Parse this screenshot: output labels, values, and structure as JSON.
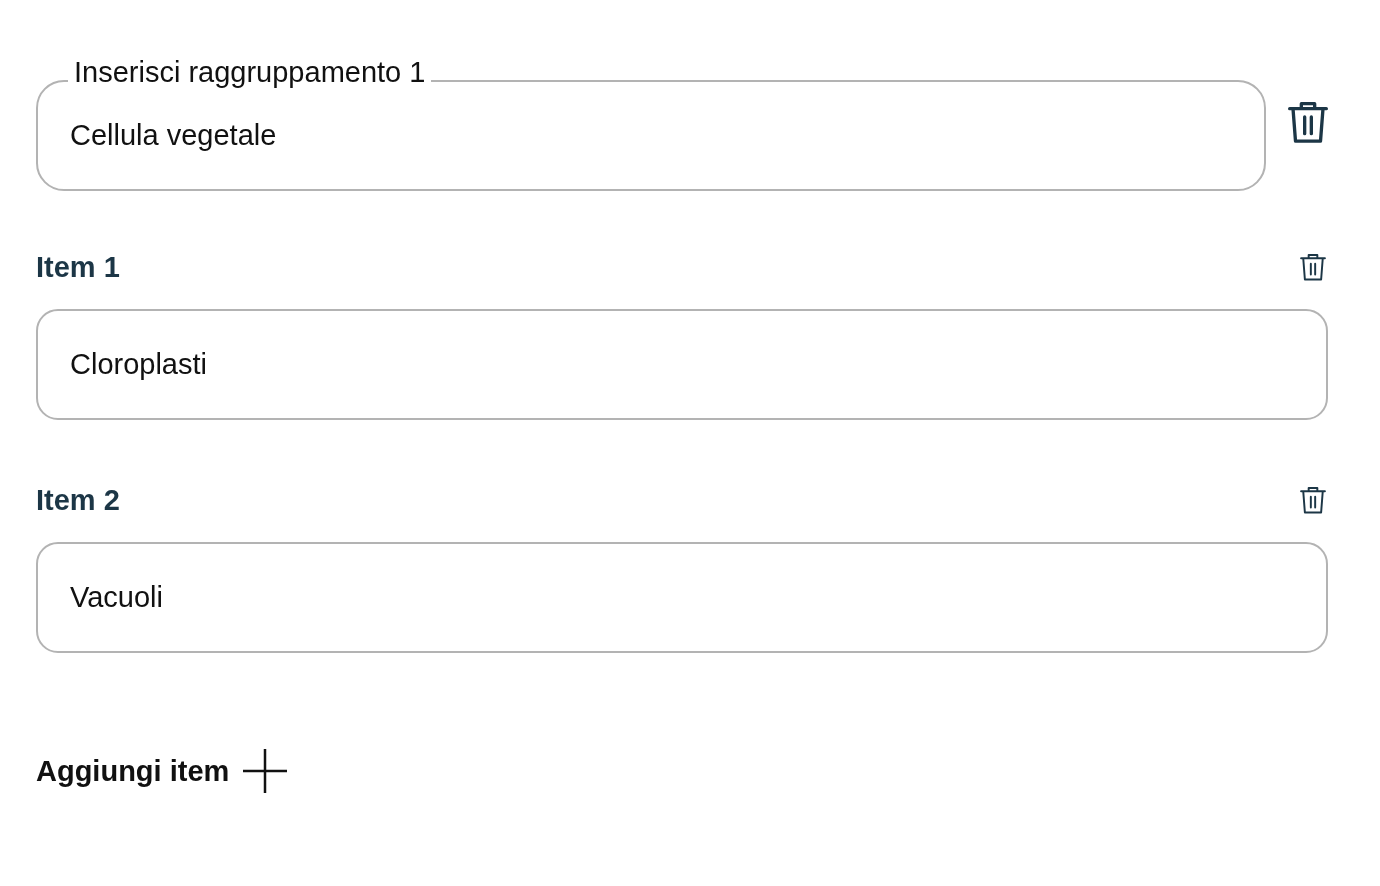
{
  "group": {
    "label": "Inserisci raggruppamento 1",
    "value": "Cellula vegetale"
  },
  "items": [
    {
      "label": "Item 1",
      "value": "Cloroplasti"
    },
    {
      "label": "Item 2",
      "value": "Vacuoli"
    }
  ],
  "add_button": {
    "label": "Aggiungi item"
  }
}
